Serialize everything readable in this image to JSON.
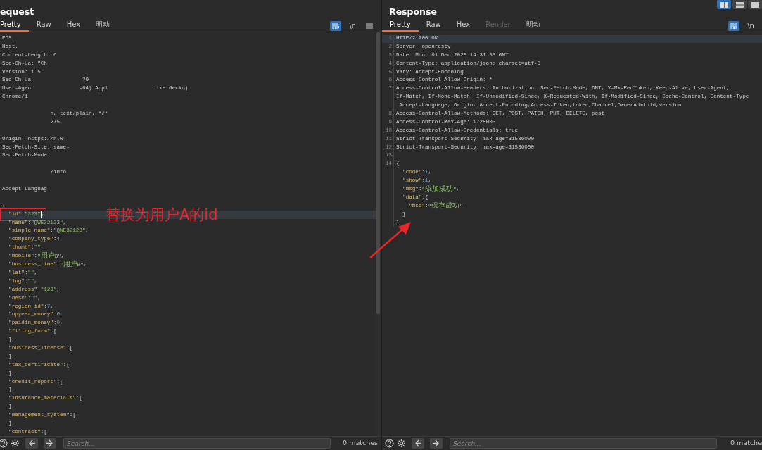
{
  "layout_buttons": [
    {
      "kind": "columns",
      "selected": true
    },
    {
      "kind": "rows",
      "selected": false
    },
    {
      "kind": "single",
      "selected": false
    }
  ],
  "panels": [
    {
      "title": "equest",
      "scrollbar": true,
      "tabs": [
        {
          "label": "Pretty",
          "selected": true,
          "disabled": false
        },
        {
          "label": "Raw",
          "selected": false,
          "disabled": false
        },
        {
          "label": "Hex",
          "selected": false,
          "disabled": false
        },
        {
          "label": "明动",
          "selected": false,
          "disabled": false
        }
      ],
      "tools": [
        {
          "kind": "wrap",
          "on": true
        },
        {
          "kind": "newline",
          "label": "\\n",
          "on": false
        },
        {
          "kind": "menu",
          "on": false
        }
      ],
      "lines": [
        {
          "selected": false,
          "tokens": [
            {
              "kind": "plain",
              "text": "POS"
            }
          ]
        },
        {
          "selected": false,
          "tokens": [
            {
              "kind": "plain",
              "text": "Host."
            }
          ]
        },
        {
          "selected": false,
          "tokens": [
            {
              "kind": "plain",
              "text": "Content-Length: 6"
            }
          ]
        },
        {
          "selected": false,
          "tokens": [
            {
              "kind": "plain",
              "text": "Sec-Ch-Ua: \"Ch"
            }
          ]
        },
        {
          "selected": false,
          "tokens": [
            {
              "kind": "plain",
              "text": "Version: 1.5"
            }
          ]
        },
        {
          "selected": false,
          "tokens": [
            {
              "kind": "plain",
              "text": "Sec-Ch-Ua-"
            },
            {
              "kind": "fragment",
              "text": "?0"
            }
          ]
        },
        {
          "selected": false,
          "tokens": [
            {
              "kind": "plain",
              "text": "User-Agen"
            },
            {
              "kind": "fragment",
              "text": "-64) Appl"
            },
            {
              "kind": "fragment",
              "text": "ike Gecko)"
            }
          ]
        },
        {
          "selected": false,
          "tokens": [
            {
              "kind": "plain",
              "text": "Chrome/1"
            }
          ]
        },
        {
          "selected": false
        },
        {
          "selected": false,
          "tokens": [
            {
              "kind": "fragment",
              "text": "n, text/plain, */*"
            }
          ]
        },
        {
          "selected": false,
          "tokens": [
            {
              "kind": "fragment",
              "text": "275"
            }
          ]
        },
        {
          "selected": false
        },
        {
          "selected": false,
          "tokens": [
            {
              "kind": "plain",
              "text": "Origin: https://h.w"
            }
          ]
        },
        {
          "selected": false,
          "tokens": [
            {
              "kind": "plain",
              "text": "Sec-Fetch-Site: same-"
            }
          ]
        },
        {
          "selected": false,
          "tokens": [
            {
              "kind": "plain",
              "text": "Sec-Fetch-Mode:"
            }
          ]
        },
        {
          "selected": false
        },
        {
          "selected": false,
          "tokens": [
            {
              "kind": "fragment",
              "text": "/info"
            }
          ]
        },
        {
          "selected": false
        },
        {
          "selected": false,
          "tokens": [
            {
              "kind": "plain",
              "text": "Accept-Languag"
            }
          ]
        },
        {
          "selected": false
        },
        {
          "selected": false,
          "tokens": [
            {
              "kind": "punct",
              "text": "{"
            }
          ]
        },
        {
          "selected": true,
          "boxed": true,
          "tokens": [
            {
              "kind": "key",
              "text": "  \"id\""
            },
            {
              "kind": "punct",
              "text": ":"
            },
            {
              "kind": "str",
              "text": "\"323\""
            },
            {
              "kind": "punct",
              "text": ","
            }
          ]
        },
        {
          "selected": false,
          "tokens": [
            {
              "kind": "key",
              "text": "  \"name\""
            },
            {
              "kind": "punct",
              "text": ":"
            },
            {
              "kind": "str",
              "text": "\"QWE32123\""
            },
            {
              "kind": "punct",
              "text": ","
            }
          ]
        },
        {
          "selected": false,
          "tokens": [
            {
              "kind": "key",
              "text": "  \"simple_name\""
            },
            {
              "kind": "punct",
              "text": ":"
            },
            {
              "kind": "str",
              "text": "\"QWE32123\""
            },
            {
              "kind": "punct",
              "text": ","
            }
          ]
        },
        {
          "selected": false,
          "tokens": [
            {
              "kind": "key",
              "text": "  \"company_type\""
            },
            {
              "kind": "punct",
              "text": ":"
            },
            {
              "kind": "num",
              "text": "4"
            },
            {
              "kind": "punct",
              "text": ","
            }
          ]
        },
        {
          "selected": false,
          "tokens": [
            {
              "kind": "key",
              "text": "  \"thumb\""
            },
            {
              "kind": "punct",
              "text": ":"
            },
            {
              "kind": "str",
              "text": "\"\""
            },
            {
              "kind": "punct",
              "text": ","
            }
          ]
        },
        {
          "selected": false,
          "tokens": [
            {
              "kind": "key",
              "text": "  \"mobile\""
            },
            {
              "kind": "punct",
              "text": ":"
            },
            {
              "kind": "str",
              "text": "\"用户B\""
            },
            {
              "kind": "punct",
              "text": ","
            }
          ]
        },
        {
          "selected": false,
          "tokens": [
            {
              "kind": "key",
              "text": "  \"business_time\""
            },
            {
              "kind": "punct",
              "text": ":"
            },
            {
              "kind": "str",
              "text": "\"用户B\""
            },
            {
              "kind": "punct",
              "text": ","
            }
          ]
        },
        {
          "selected": false,
          "tokens": [
            {
              "kind": "key",
              "text": "  \"lat\""
            },
            {
              "kind": "punct",
              "text": ":"
            },
            {
              "kind": "str",
              "text": "\"\""
            },
            {
              "kind": "punct",
              "text": ","
            }
          ]
        },
        {
          "selected": false,
          "tokens": [
            {
              "kind": "key",
              "text": "  \"lng\""
            },
            {
              "kind": "punct",
              "text": ":"
            },
            {
              "kind": "str",
              "text": "\"\""
            },
            {
              "kind": "punct",
              "text": ","
            }
          ]
        },
        {
          "selected": false,
          "tokens": [
            {
              "kind": "key",
              "text": "  \"address\""
            },
            {
              "kind": "punct",
              "text": ":"
            },
            {
              "kind": "str",
              "text": "\"123\""
            },
            {
              "kind": "punct",
              "text": ","
            }
          ]
        },
        {
          "selected": false,
          "tokens": [
            {
              "kind": "key",
              "text": "  \"desc\""
            },
            {
              "kind": "punct",
              "text": ":"
            },
            {
              "kind": "str",
              "text": "\"\""
            },
            {
              "kind": "punct",
              "text": ","
            }
          ]
        },
        {
          "selected": false,
          "tokens": [
            {
              "kind": "key",
              "text": "  \"region_id\""
            },
            {
              "kind": "punct",
              "text": ":"
            },
            {
              "kind": "num",
              "text": "7"
            },
            {
              "kind": "punct",
              "text": ","
            }
          ]
        },
        {
          "selected": false,
          "tokens": [
            {
              "kind": "key",
              "text": "  \"upyear_money\""
            },
            {
              "kind": "punct",
              "text": ":"
            },
            {
              "kind": "num",
              "text": "0"
            },
            {
              "kind": "punct",
              "text": ","
            }
          ]
        },
        {
          "selected": false,
          "tokens": [
            {
              "kind": "key",
              "text": "  \"paidin_money\""
            },
            {
              "kind": "punct",
              "text": ":"
            },
            {
              "kind": "num",
              "text": "0"
            },
            {
              "kind": "punct",
              "text": ","
            }
          ]
        },
        {
          "selected": false,
          "tokens": [
            {
              "kind": "key",
              "text": "  \"filing_form\""
            },
            {
              "kind": "punct",
              "text": ":["
            }
          ]
        },
        {
          "selected": false,
          "tokens": [
            {
              "kind": "punct",
              "text": "  ],"
            }
          ]
        },
        {
          "selected": false,
          "tokens": [
            {
              "kind": "key",
              "text": "  \"business_license\""
            },
            {
              "kind": "punct",
              "text": ":["
            }
          ]
        },
        {
          "selected": false,
          "tokens": [
            {
              "kind": "punct",
              "text": "  ],"
            }
          ]
        },
        {
          "selected": false,
          "tokens": [
            {
              "kind": "key",
              "text": "  \"tax_certificate\""
            },
            {
              "kind": "punct",
              "text": ":["
            }
          ]
        },
        {
          "selected": false,
          "tokens": [
            {
              "kind": "punct",
              "text": "  ],"
            }
          ]
        },
        {
          "selected": false,
          "tokens": [
            {
              "kind": "key",
              "text": "  \"credit_report\""
            },
            {
              "kind": "punct",
              "text": ":["
            }
          ]
        },
        {
          "selected": false,
          "tokens": [
            {
              "kind": "punct",
              "text": "  ],"
            }
          ]
        },
        {
          "selected": false,
          "tokens": [
            {
              "kind": "key",
              "text": "  \"insurance_materials\""
            },
            {
              "kind": "punct",
              "text": ":["
            }
          ]
        },
        {
          "selected": false,
          "tokens": [
            {
              "kind": "punct",
              "text": "  ],"
            }
          ]
        },
        {
          "selected": false,
          "tokens": [
            {
              "kind": "key",
              "text": "  \"management_system\""
            },
            {
              "kind": "punct",
              "text": ":["
            }
          ]
        },
        {
          "selected": false,
          "tokens": [
            {
              "kind": "punct",
              "text": "  ],"
            }
          ]
        },
        {
          "selected": false,
          "tokens": [
            {
              "kind": "key",
              "text": "  \"contract\""
            },
            {
              "kind": "punct",
              "text": ":["
            }
          ]
        }
      ],
      "search": {
        "placeholder": "Search...",
        "matches": "0 matches"
      }
    },
    {
      "title": "Response",
      "tabs": [
        {
          "label": "Pretty",
          "selected": true,
          "disabled": false
        },
        {
          "label": "Raw",
          "selected": false,
          "disabled": false
        },
        {
          "label": "Hex",
          "selected": false,
          "disabled": false
        },
        {
          "label": "Render",
          "selected": false,
          "disabled": true
        },
        {
          "label": "明动",
          "selected": false,
          "disabled": false
        }
      ],
      "tools": [
        {
          "kind": "wrap",
          "on": true
        },
        {
          "kind": "newline",
          "label": "\\n",
          "on": false
        }
      ],
      "lines": [
        {
          "number": "1",
          "selected": true,
          "tokens": [
            {
              "kind": "plain",
              "text": "HTTP/2 200 OK"
            }
          ]
        },
        {
          "number": "2",
          "selected": false,
          "tokens": [
            {
              "kind": "plain",
              "text": "Server: openresty"
            }
          ]
        },
        {
          "number": "3",
          "selected": false,
          "tokens": [
            {
              "kind": "plain",
              "text": "Date: Mon, 01 Dec 2025 14:31:53 GMT"
            }
          ]
        },
        {
          "number": "4",
          "selected": false,
          "tokens": [
            {
              "kind": "plain",
              "text": "Content-Type: application/json; charset=utf-8"
            }
          ]
        },
        {
          "number": "5",
          "selected": false,
          "tokens": [
            {
              "kind": "plain",
              "text": "Vary: Accept-Encoding"
            }
          ]
        },
        {
          "number": "6",
          "selected": false,
          "tokens": [
            {
              "kind": "plain",
              "text": "Access-Control-Allow-Origin: *"
            }
          ]
        },
        {
          "number": "7",
          "selected": false,
          "tokens": [
            {
              "kind": "plain",
              "text": "Access-Control-Allow-Headers: Authorization, Sec-Fetch-Mode, DNT, X-Mx-ReqToken, Keep-Alive, User-Agent,"
            }
          ]
        },
        {
          "selected": false,
          "tokens": [
            {
              "kind": "plain",
              "text": "If-Match, If-None-Match, If-Unmodified-Since, X-Requested-With, If-Modified-Since, Cache-Control, Content-Type"
            }
          ]
        },
        {
          "selected": false,
          "tokens": [
            {
              "kind": "plain",
              "text": " Accept-Language, Origin, Accept-Encoding,Access-Token,token,Channel,OwnerAdminid,version"
            }
          ]
        },
        {
          "number": "8",
          "selected": false,
          "tokens": [
            {
              "kind": "plain",
              "text": "Access-Control-Allow-Methods: GET, POST, PATCH, PUT, DELETE, post"
            }
          ]
        },
        {
          "number": "9",
          "selected": false,
          "tokens": [
            {
              "kind": "plain",
              "text": "Access-Control-Max-Age: 1728000"
            }
          ]
        },
        {
          "number": "10",
          "selected": false,
          "tokens": [
            {
              "kind": "plain",
              "text": "Access-Control-Allow-Credentials: true"
            }
          ]
        },
        {
          "number": "11",
          "selected": false,
          "tokens": [
            {
              "kind": "plain",
              "text": "Strict-Transport-Security: max-age=31536000"
            }
          ]
        },
        {
          "number": "12",
          "selected": false,
          "tokens": [
            {
              "kind": "plain",
              "text": "Strict-Transport-Security: max-age=31536000"
            }
          ]
        },
        {
          "number": "13",
          "selected": false
        },
        {
          "number": "14",
          "selected": false,
          "tokens": [
            {
              "kind": "punct",
              "text": "{"
            }
          ]
        },
        {
          "selected": false,
          "tokens": [
            {
              "kind": "key",
              "text": "  \"code\""
            },
            {
              "kind": "punct",
              "text": ":"
            },
            {
              "kind": "num",
              "text": "1"
            },
            {
              "kind": "punct",
              "text": ","
            }
          ]
        },
        {
          "selected": false,
          "tokens": [
            {
              "kind": "key",
              "text": "  \"show\""
            },
            {
              "kind": "punct",
              "text": ":"
            },
            {
              "kind": "num",
              "text": "1"
            },
            {
              "kind": "punct",
              "text": ","
            }
          ]
        },
        {
          "selected": false,
          "tokens": [
            {
              "kind": "key",
              "text": "  \"msg\""
            },
            {
              "kind": "punct",
              "text": ":"
            },
            {
              "kind": "str",
              "text": "\"添加成功\""
            },
            {
              "kind": "punct",
              "text": ","
            }
          ]
        },
        {
          "selected": false,
          "tokens": [
            {
              "kind": "key",
              "text": "  \"data\""
            },
            {
              "kind": "punct",
              "text": ":{"
            }
          ]
        },
        {
          "selected": false,
          "tokens": [
            {
              "kind": "key",
              "text": "    \"msg\""
            },
            {
              "kind": "punct",
              "text": ":"
            },
            {
              "kind": "str",
              "text": "\"保存成功\""
            }
          ]
        },
        {
          "selected": false,
          "tokens": [
            {
              "kind": "punct",
              "text": "  }"
            }
          ]
        },
        {
          "selected": false,
          "tokens": [
            {
              "kind": "punct",
              "text": "}"
            }
          ]
        }
      ],
      "search": {
        "placeholder": "Search...",
        "matches": "0 matche"
      }
    }
  ],
  "annotation": {
    "text": "替换为用户A的id"
  }
}
